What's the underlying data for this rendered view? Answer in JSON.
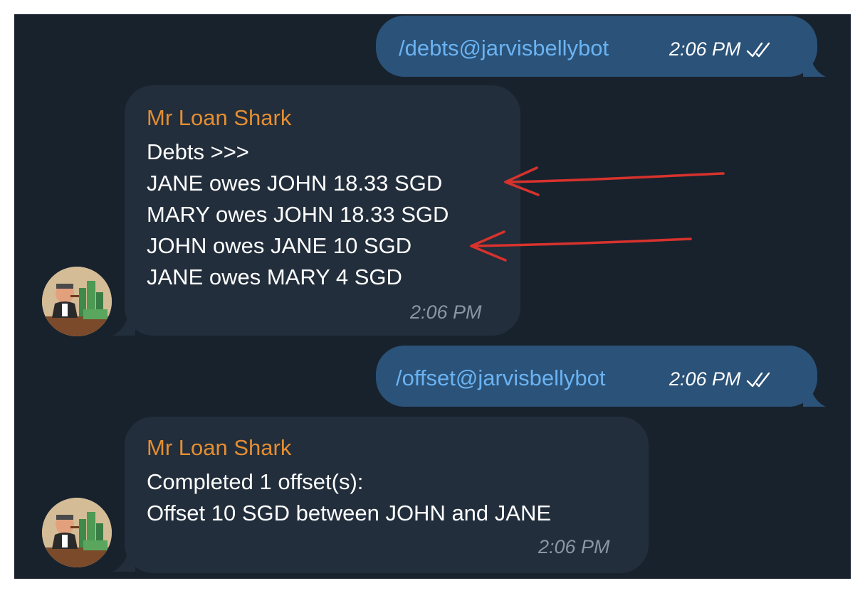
{
  "messages": {
    "m1": {
      "text": "/debts@jarvisbellybot",
      "time": "2:06 PM",
      "status_icon": "double-check-icon"
    },
    "m2": {
      "sender": "Mr Loan Shark",
      "lines": [
        "Debts >>>",
        "JANE owes JOHN 18.33 SGD",
        "MARY owes JOHN 18.33 SGD",
        "JOHN owes JANE 10 SGD",
        "JANE owes MARY 4 SGD"
      ],
      "time": "2:06 PM"
    },
    "m3": {
      "text": "/offset@jarvisbellybot",
      "time": "2:06 PM",
      "status_icon": "double-check-icon"
    },
    "m4": {
      "sender": "Mr Loan Shark",
      "lines": [
        "Completed 1 offset(s):",
        "Offset 10 SGD between JOHN and JANE"
      ],
      "time": "2:06 PM"
    }
  },
  "colors": {
    "chat_background": "#18222d",
    "outgoing_bubble": "#2b5278",
    "incoming_bubble": "#222e3b",
    "command_link": "#6ab3f3",
    "sender_name": "#e58e32",
    "annotation_arrow": "#d8322d"
  }
}
